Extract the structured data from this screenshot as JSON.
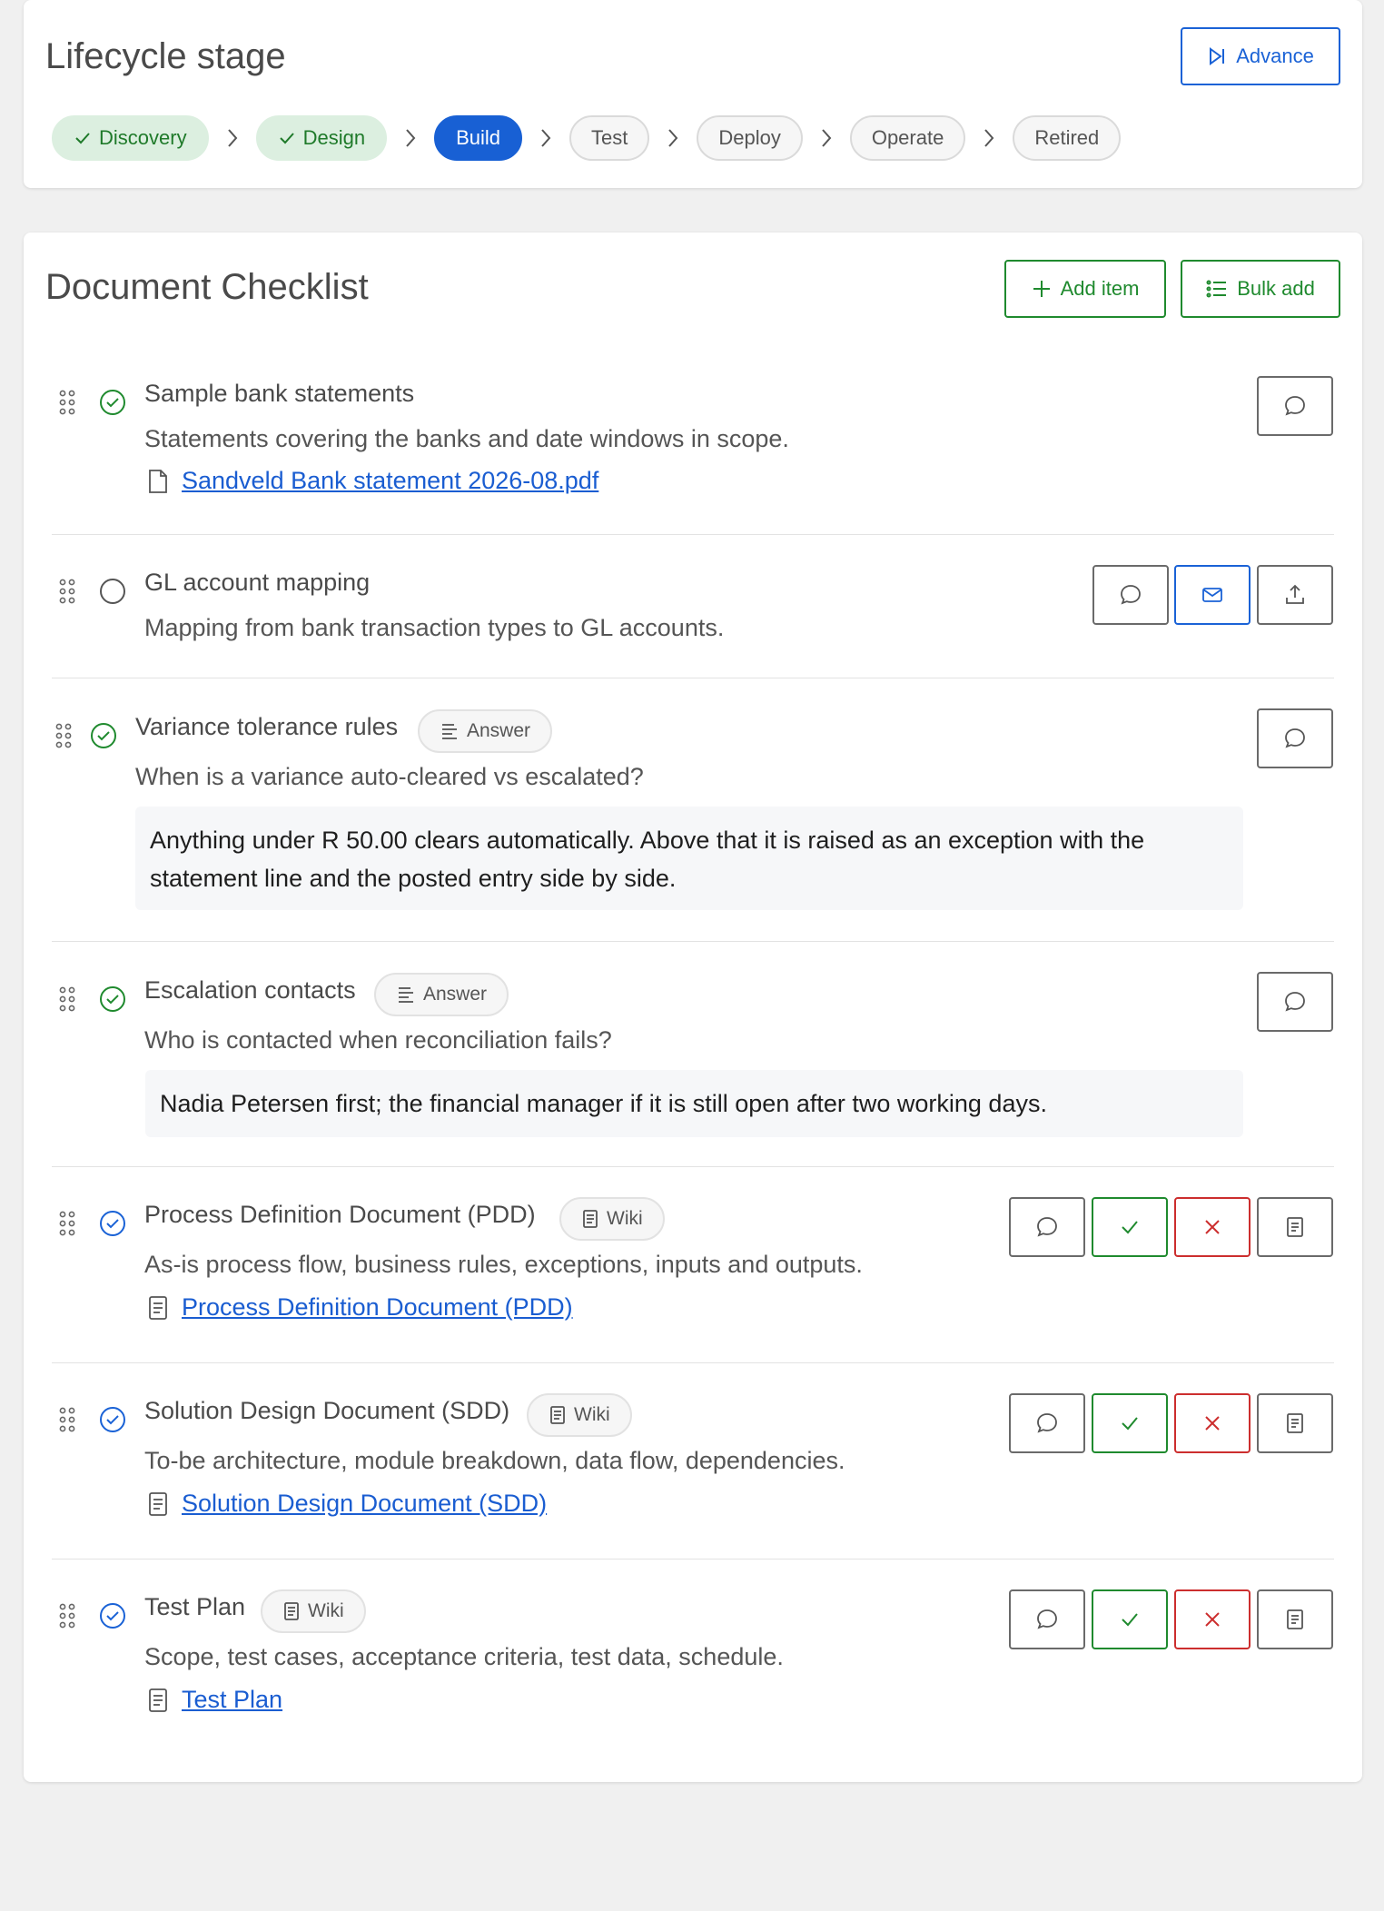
{
  "lifecycle": {
    "title": "Lifecycle stage",
    "advance_label": "Advance",
    "stages": [
      {
        "label": "Discovery",
        "status": "done"
      },
      {
        "label": "Design",
        "status": "done"
      },
      {
        "label": "Build",
        "status": "active"
      },
      {
        "label": "Test",
        "status": "pending"
      },
      {
        "label": "Deploy",
        "status": "pending"
      },
      {
        "label": "Operate",
        "status": "pending"
      },
      {
        "label": "Retired",
        "status": "pending"
      }
    ]
  },
  "checklist": {
    "title": "Document Checklist",
    "add_item_label": "Add item",
    "bulk_add_label": "Bulk add",
    "items": [
      {
        "title": "Sample bank statements",
        "status": "complete",
        "description": "Statements covering the banks and date windows in scope.",
        "attachment": "Sandveld Bank statement 2026-08.pdf",
        "actions": [
          "comment-icon"
        ]
      },
      {
        "title": "GL account mapping",
        "status": "pending",
        "description": "Mapping from bank transaction types to GL accounts.",
        "actions": [
          "comment-icon",
          "mail-icon",
          "upload-icon"
        ]
      },
      {
        "title": "Variance tolerance rules",
        "status": "complete",
        "tag": "Answer",
        "description": "When is a variance auto-cleared vs escalated?",
        "answer": "Anything under R 50.00 clears automatically. Above that it is raised as an exception with the statement line and the posted entry side by side.",
        "actions": [
          "comment-icon"
        ]
      },
      {
        "title": "Escalation contacts",
        "status": "complete",
        "tag": "Answer",
        "description": "Who is contacted when reconciliation fails?",
        "answer": "Nadia Petersen first; the financial manager if it is still open after two working days.",
        "actions": [
          "comment-icon"
        ]
      },
      {
        "title": "Process Definition Document (PDD)",
        "status": "submitted",
        "tag": "Wiki",
        "description": "As-is process flow, business rules, exceptions, inputs and outputs.",
        "wiki_link": "Process Definition Document (PDD)",
        "actions": [
          "comment-icon",
          "approve-icon",
          "reject-icon",
          "wiki-icon"
        ]
      },
      {
        "title": "Solution Design Document (SDD)",
        "status": "submitted",
        "tag": "Wiki",
        "description": "To-be architecture, module breakdown, data flow, dependencies.",
        "wiki_link": "Solution Design Document (SDD)",
        "actions": [
          "comment-icon",
          "approve-icon",
          "reject-icon",
          "wiki-icon"
        ]
      },
      {
        "title": "Test Plan",
        "status": "submitted",
        "tag": "Wiki",
        "description": "Scope, test cases, acceptance criteria, test data, schedule.",
        "wiki_link": "Test Plan",
        "actions": [
          "comment-icon",
          "approve-icon",
          "reject-icon",
          "wiki-icon"
        ]
      }
    ]
  },
  "colors": {
    "primary": "#1860d4",
    "success": "#1f8a2e",
    "danger": "#cc2e2e",
    "done_bg": "#dcefe0"
  }
}
